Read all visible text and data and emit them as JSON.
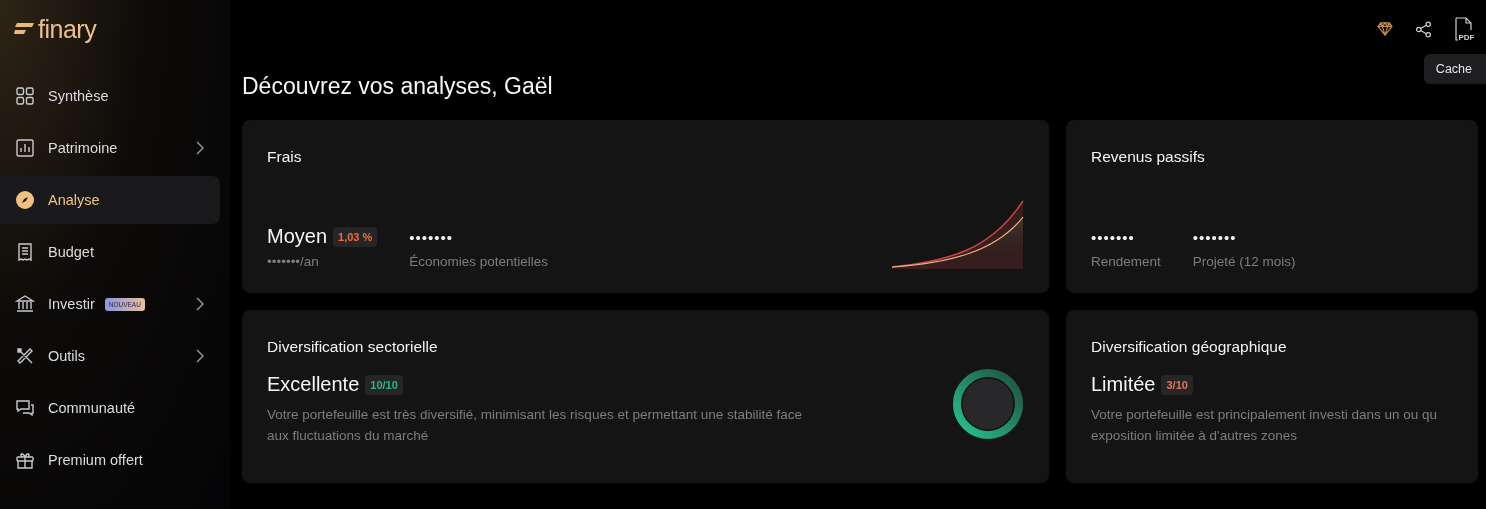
{
  "brand": {
    "name": "finary"
  },
  "sidebar": {
    "items": [
      {
        "label": "Synthèse",
        "selected": false,
        "has_submenu": false
      },
      {
        "label": "Patrimoine",
        "selected": false,
        "has_submenu": true
      },
      {
        "label": "Analyse",
        "selected": true,
        "has_submenu": false
      },
      {
        "label": "Budget",
        "selected": false,
        "has_submenu": false
      },
      {
        "label": "Investir",
        "selected": false,
        "has_submenu": true,
        "badge": "NOUVEAU"
      },
      {
        "label": "Outils",
        "selected": false,
        "has_submenu": true
      },
      {
        "label": "Communauté",
        "selected": false,
        "has_submenu": false
      },
      {
        "label": "Premium offert",
        "selected": false,
        "has_submenu": false
      }
    ]
  },
  "toolbar": {
    "pdf_label": "PDF",
    "tooltip": "Cache"
  },
  "page_title": "Découvrez vos analyses, Gaël",
  "cards": [
    {
      "kind": "fees",
      "title": "Frais",
      "headline": {
        "text": "Moyen",
        "badge": "1,03 %",
        "color": "#f26b3a",
        "sub": "•••••••/an"
      },
      "stats": [
        {
          "value": "•••••••",
          "label": "Économies potentielles"
        }
      ]
    },
    {
      "kind": "income",
      "title": "Revenus passifs",
      "stats": [
        {
          "value": "•••••••",
          "label": "Rendement"
        },
        {
          "value": "•••••••",
          "label": "Projeté (12 mois)"
        }
      ]
    },
    {
      "kind": "score",
      "title": "Diversification sectorielle",
      "headline": {
        "text": "Excellente",
        "badge": "10/10",
        "color": "#2bb583"
      },
      "description": "Votre portefeuille est très diversifié, minimisant les risques et permettant une stabilité face\naux fluctuations du marché",
      "level": 1
    },
    {
      "kind": "score",
      "title": "Diversification géographique",
      "headline": {
        "text": "Limitée",
        "badge": "3/10",
        "color": "#e8715e"
      },
      "description": "Votre portefeuille est principalement investi dans un ou qu\nexposition limitée à d'autres zones"
    }
  ]
}
